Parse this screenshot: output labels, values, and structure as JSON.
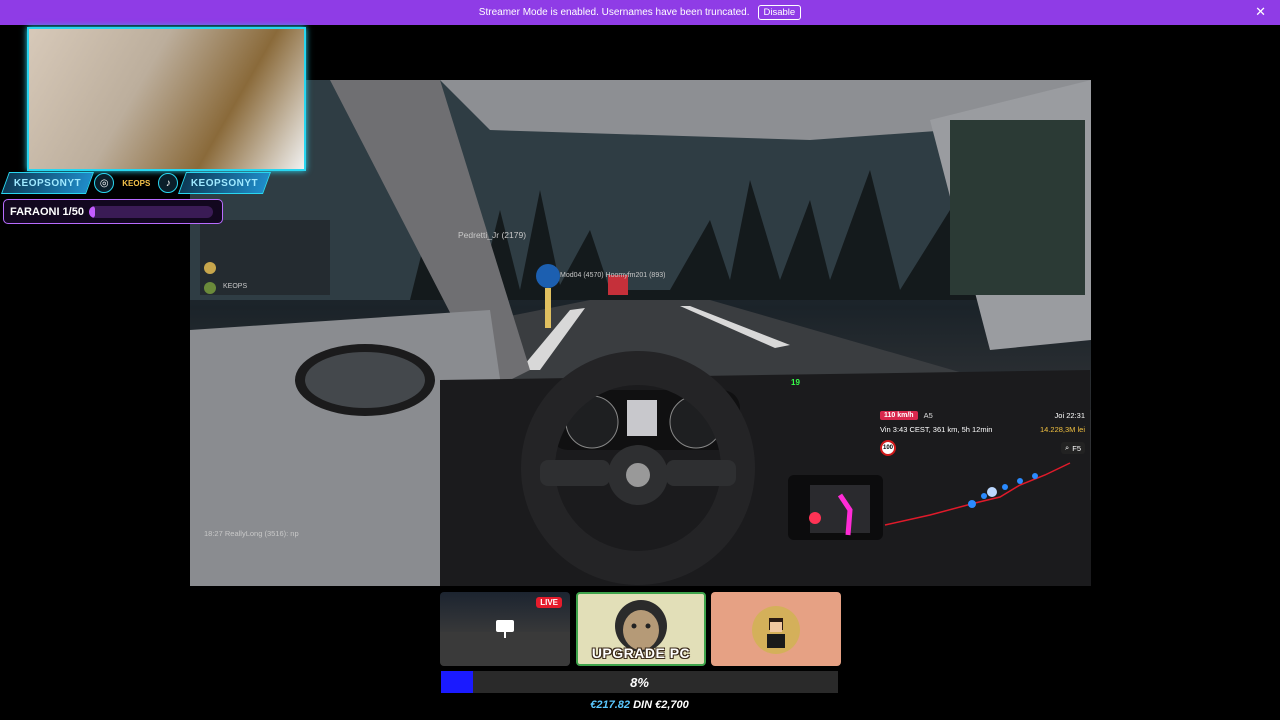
{
  "banner": {
    "message": "Streamer Mode is enabled. Usernames have been truncated.",
    "disable_label": "Disable",
    "close_glyph": "✕"
  },
  "webcam": {
    "social": {
      "instagram_handle": "KEOPSONYT",
      "instagram_icon": "instagram-icon",
      "tiktok_handle": "KEOPSONYT",
      "tiktok_icon": "tiktok-icon",
      "logo_text": "KEOPS"
    }
  },
  "goal": {
    "label": "FARAONI 1/50",
    "progress": 0.02,
    "accent": "#c35cff"
  },
  "game": {
    "player_tag": "Pedretti_Jr (2179)",
    "nearby_players": "Mod04 (4570)     Hoomyfm201 (893)",
    "chat_line": "18:27 ReallyLong (3516): np",
    "chat_users": [
      "KEOPS"
    ],
    "hud": {
      "speed_limit": "110 km/h",
      "road": "A5",
      "time": "Joi 22:31",
      "eta": "Vin 3:43 CEST, 361 km, 5h 12min",
      "money": "14.228,3M lei",
      "sign": "100",
      "search_key": "F5",
      "dash_speed": "19"
    }
  },
  "thumbs": {
    "live_label": "LIVE",
    "upgrade_label": "UPGRADE PC"
  },
  "donation": {
    "percent_label": "8%",
    "progress": 0.08,
    "raised": "€217.82",
    "separator": "DIN",
    "target": "€2,700",
    "accent": "#1a1aff"
  }
}
